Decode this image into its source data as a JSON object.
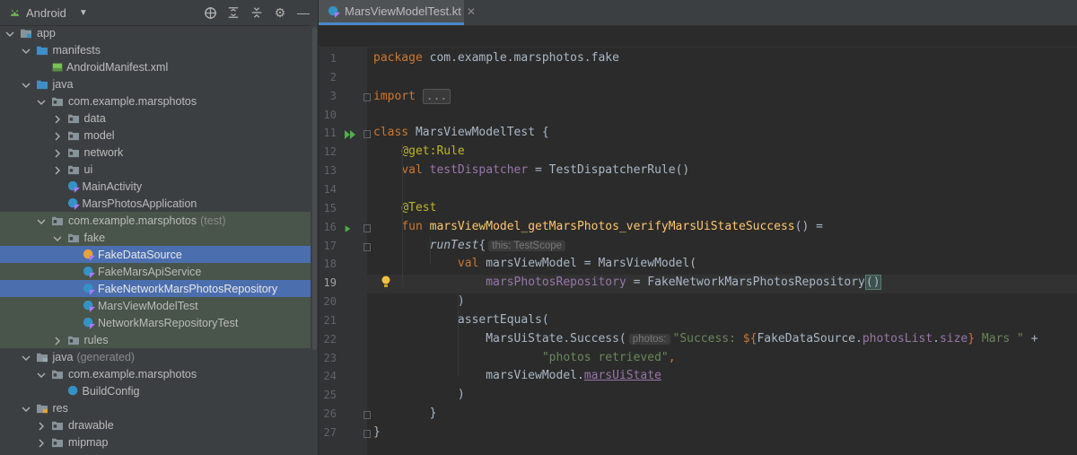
{
  "project_panel": {
    "view_selector": "Android",
    "tree": [
      {
        "label": "app",
        "depth": 0,
        "kind": "module",
        "expanded": true
      },
      {
        "label": "manifests",
        "depth": 1,
        "kind": "folder-blue",
        "expanded": true
      },
      {
        "label": "AndroidManifest.xml",
        "depth": 2,
        "kind": "xml"
      },
      {
        "label": "java",
        "depth": 1,
        "kind": "folder-blue",
        "expanded": true
      },
      {
        "label": "com.example.marsphotos",
        "depth": 2,
        "kind": "package",
        "expanded": true
      },
      {
        "label": "data",
        "depth": 3,
        "kind": "package",
        "expanded": false
      },
      {
        "label": "model",
        "depth": 3,
        "kind": "package",
        "expanded": false
      },
      {
        "label": "network",
        "depth": 3,
        "kind": "package",
        "expanded": false
      },
      {
        "label": "ui",
        "depth": 3,
        "kind": "package",
        "expanded": false
      },
      {
        "label": "MainActivity",
        "depth": 3,
        "kind": "kotlin"
      },
      {
        "label": "MarsPhotosApplication",
        "depth": 3,
        "kind": "kotlin"
      },
      {
        "label": "com.example.marsphotos",
        "suffix": "(test)",
        "depth": 2,
        "kind": "package",
        "expanded": true,
        "test": true
      },
      {
        "label": "fake",
        "depth": 3,
        "kind": "package",
        "expanded": true,
        "test": true
      },
      {
        "label": "FakeDataSource",
        "depth": 4,
        "kind": "kotlin-object",
        "selected": true
      },
      {
        "label": "FakeMarsApiService",
        "depth": 4,
        "kind": "kotlin",
        "test": true
      },
      {
        "label": "FakeNetworkMarsPhotosRepository",
        "depth": 4,
        "kind": "kotlin",
        "selected": true
      },
      {
        "label": "MarsViewModelTest",
        "depth": 4,
        "kind": "kotlin",
        "test": true
      },
      {
        "label": "NetworkMarsRepositoryTest",
        "depth": 4,
        "kind": "kotlin",
        "test": true
      },
      {
        "label": "rules",
        "depth": 3,
        "kind": "package",
        "expanded": false,
        "test": true
      },
      {
        "label": "java",
        "suffix": "(generated)",
        "depth": 1,
        "kind": "folder-gen",
        "expanded": true
      },
      {
        "label": "com.example.marsphotos",
        "depth": 2,
        "kind": "package",
        "expanded": true
      },
      {
        "label": "BuildConfig",
        "depth": 3,
        "kind": "class"
      },
      {
        "label": "res",
        "depth": 1,
        "kind": "folder-res",
        "expanded": true
      },
      {
        "label": "drawable",
        "depth": 2,
        "kind": "package",
        "expanded": false
      },
      {
        "label": "mipmap",
        "depth": 2,
        "kind": "package",
        "expanded": false
      }
    ]
  },
  "editor": {
    "tab_label": "MarsViewModelTest.kt",
    "current_line": 19,
    "lines": [
      {
        "num": "1",
        "tokens": [
          [
            "kw",
            "package "
          ],
          [
            "",
            "com.example.marsphotos.fake"
          ]
        ]
      },
      {
        "num": "2",
        "tokens": []
      },
      {
        "num": "3",
        "tokens": [
          [
            "kw",
            "import "
          ],
          [
            "fold",
            "..."
          ]
        ]
      },
      {
        "num": "10",
        "tokens": []
      },
      {
        "num": "11",
        "tokens": [
          [
            "kw",
            "class "
          ],
          [
            "",
            "MarsViewModelTest {"
          ]
        ]
      },
      {
        "num": "12",
        "tokens": [
          [
            "",
            "    "
          ],
          [
            "ann",
            "@get:Rule"
          ]
        ]
      },
      {
        "num": "13",
        "tokens": [
          [
            "",
            "    "
          ],
          [
            "kw",
            "val "
          ],
          [
            "prop",
            "testDispatcher"
          ],
          [
            "",
            " = TestDispatcherRule()"
          ]
        ]
      },
      {
        "num": "14",
        "tokens": []
      },
      {
        "num": "15",
        "tokens": [
          [
            "",
            "    "
          ],
          [
            "ann",
            "@Test"
          ]
        ]
      },
      {
        "num": "16",
        "tokens": [
          [
            "",
            "    "
          ],
          [
            "kw",
            "fun "
          ],
          [
            "fn",
            "marsViewModel_getMarsPhotos_verifyMarsUiStateSuccess"
          ],
          [
            "",
            "() ="
          ]
        ]
      },
      {
        "num": "17",
        "tokens": [
          [
            "",
            "        "
          ],
          [
            "it",
            "runTest"
          ],
          [
            "",
            "{"
          ],
          [
            "hint",
            "this: TestScope"
          ]
        ]
      },
      {
        "num": "18",
        "tokens": [
          [
            "",
            "            "
          ],
          [
            "kw",
            "val "
          ],
          [
            "",
            "marsViewModel = MarsViewModel("
          ]
        ]
      },
      {
        "num": "19",
        "tokens": [
          [
            "",
            "                "
          ],
          [
            "prop",
            "marsPhotosRepository"
          ],
          [
            "",
            " = FakeNetworkMarsPhotosRepository"
          ],
          [
            "brace",
            "()"
          ]
        ]
      },
      {
        "num": "20",
        "tokens": [
          [
            "",
            "            )"
          ]
        ]
      },
      {
        "num": "21",
        "tokens": [
          [
            "",
            "            assertEquals("
          ]
        ]
      },
      {
        "num": "22",
        "tokens": [
          [
            "",
            "                MarsUiState.Success("
          ],
          [
            "hint",
            "photos:"
          ],
          [
            "str",
            "\"Success: "
          ],
          [
            "kw",
            "${"
          ],
          [
            "",
            "FakeDataSource."
          ],
          [
            "prop",
            "photosList"
          ],
          [
            "",
            "."
          ],
          [
            "prop",
            "size"
          ],
          [
            "kw",
            "}"
          ],
          [
            "str",
            " Mars \""
          ],
          [
            "",
            " +"
          ]
        ]
      },
      {
        "num": "23",
        "tokens": [
          [
            "",
            "                        "
          ],
          [
            "str",
            "\"photos retrieved\""
          ],
          [
            "kw",
            ","
          ]
        ]
      },
      {
        "num": "24",
        "tokens": [
          [
            "",
            "                marsViewModel."
          ],
          [
            "under",
            "marsUiState"
          ]
        ]
      },
      {
        "num": "25",
        "tokens": [
          [
            "",
            "            )"
          ]
        ]
      },
      {
        "num": "26",
        "tokens": [
          [
            "",
            "        }"
          ]
        ]
      },
      {
        "num": "27",
        "tokens": [
          [
            "",
            "}"
          ]
        ]
      }
    ]
  }
}
